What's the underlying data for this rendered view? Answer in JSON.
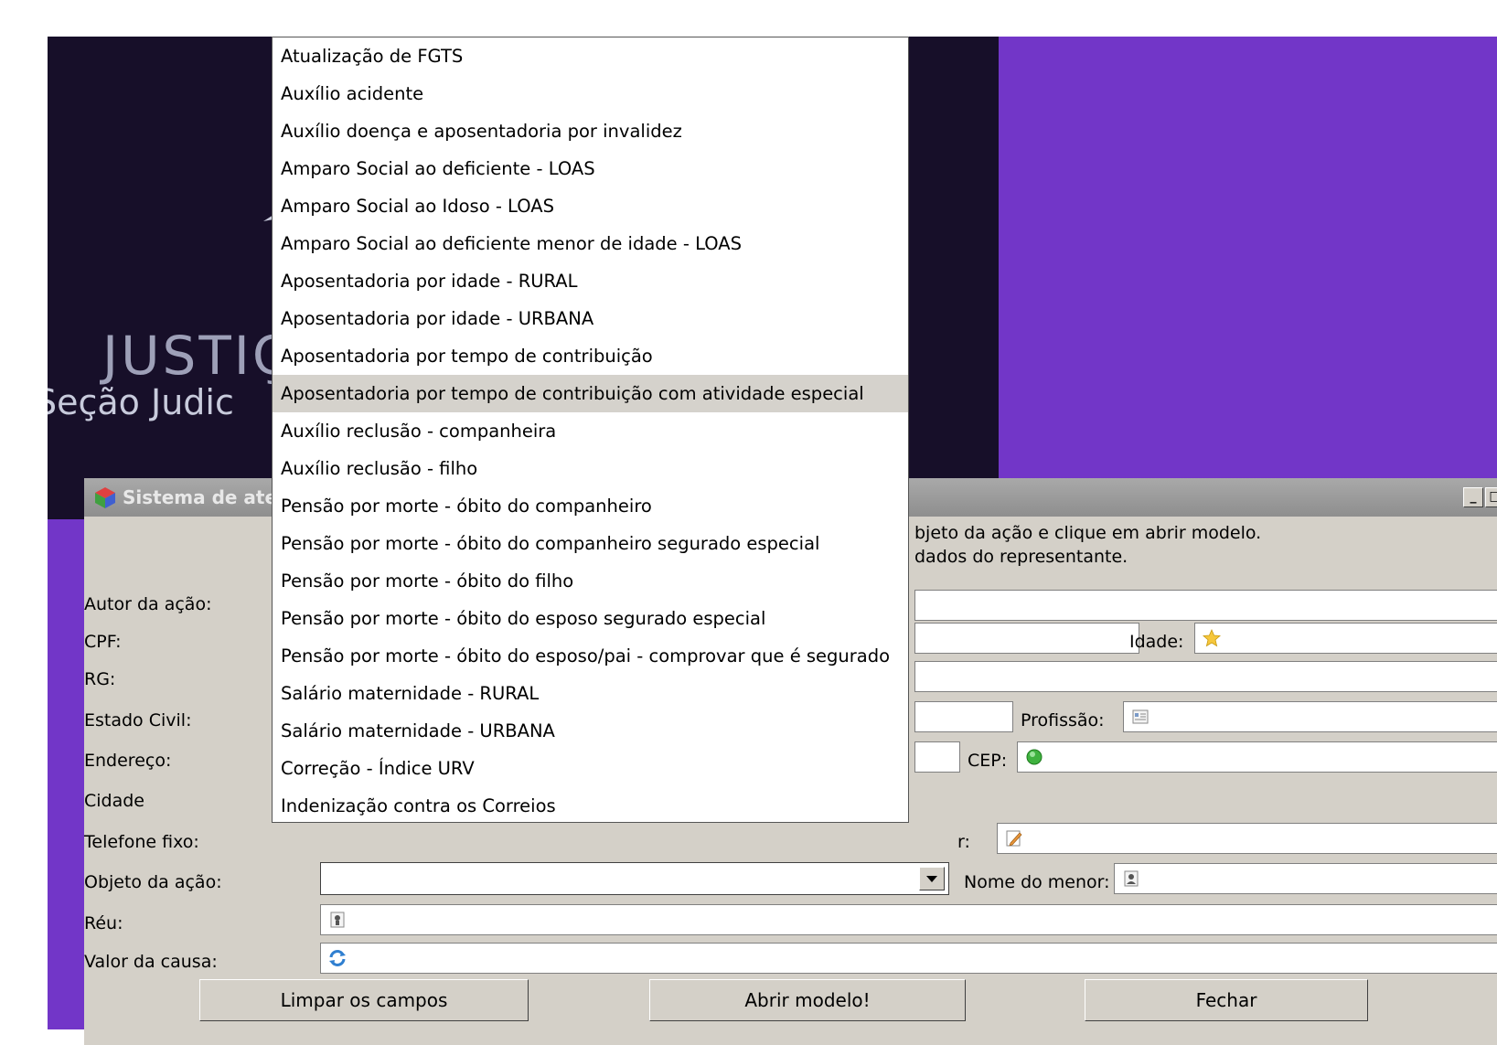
{
  "splash": {
    "word1": "JUSTIÇ",
    "word2": "Seção Judic"
  },
  "window": {
    "title": "Sistema de ate",
    "controls": {
      "minimize": "_",
      "maximize": "□"
    },
    "instructions": [
      "bjeto da ação e clique em abrir modelo.",
      "dados do representante."
    ]
  },
  "form": {
    "autor_label": "Autor da ação:",
    "cpf_label": "CPF:",
    "idade_label": "Idade:",
    "rg_label": "RG:",
    "estado_civil_label": "Estado Civil:",
    "profissao_label": "Profissão:",
    "endereco_label": "Endereço:",
    "cep_label": "CEP:",
    "cidade_label": "Cidade",
    "telefone_label": "Telefone fixo:",
    "celular_label_partial": "r:",
    "objeto_label": "Objeto da ação:",
    "objeto_value": "",
    "nome_menor_label": "Nome do menor:",
    "reu_label": "Réu:",
    "valor_label": "Valor da causa:"
  },
  "buttons": {
    "limpar": "Limpar os campos",
    "abrir": "Abrir modelo!",
    "fechar": "Fechar"
  },
  "dropdown": {
    "selected_index": 9,
    "options": [
      "Atualização de FGTS",
      "Auxílio acidente",
      "Auxílio doença e aposentadoria por invalidez",
      "Amparo Social ao deficiente - LOAS",
      "Amparo Social ao Idoso - LOAS",
      "Amparo Social ao deficiente menor de idade - LOAS",
      "Aposentadoria por idade - RURAL",
      "Aposentadoria por idade - URBANA",
      "Aposentadoria por tempo de contribuição",
      "Aposentadoria por tempo de contribuição com atividade especial",
      "Auxílio reclusão - companheira",
      "Auxílio reclusão - filho",
      "Pensão por morte - óbito do companheiro",
      "Pensão por morte - óbito do companheiro segurado especial",
      "Pensão por morte - óbito do filho",
      "Pensão por morte - óbito do esposo segurado especial",
      "Pensão por morte - óbito do esposo/pai - comprovar que é segurado",
      "Salário maternidade - RURAL",
      "Salário maternidade - URBANA",
      "Correção - Índice URV",
      "Indenização contra os Correios"
    ]
  },
  "colors": {
    "desktop": "#7236c8",
    "splash": "#170f29",
    "window": "#d4d0c8",
    "selected_option": "#d5d2cc"
  }
}
